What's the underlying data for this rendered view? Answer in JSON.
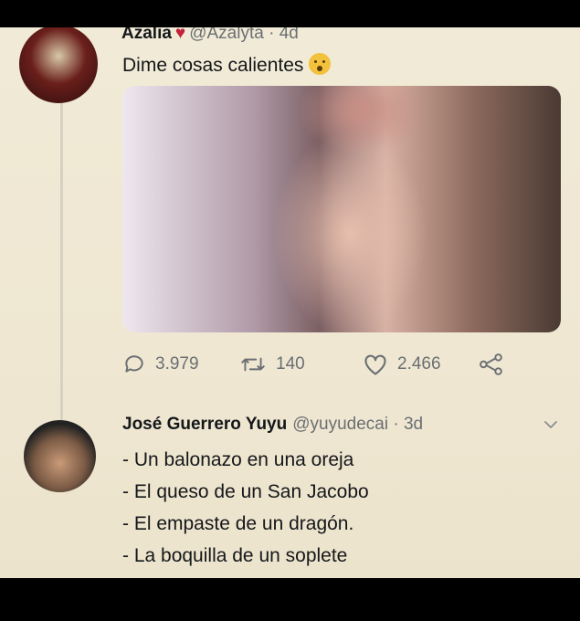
{
  "tweet1": {
    "name": "Azalia",
    "handle": "@Azalyta",
    "age": "4d",
    "text": "Dime cosas calientes",
    "stats": {
      "replies": "3.979",
      "retweets": "140",
      "likes": "2.466"
    }
  },
  "tweet2": {
    "name": "José Guerrero Yuyu",
    "handle": "@yuyudecai",
    "age": "3d",
    "lines": [
      "- Un balonazo en una oreja",
      "- El queso de un San Jacobo",
      "- El empaste de un dragón.",
      "- La boquilla de un soplete"
    ]
  },
  "icons": {
    "reply": "comment-icon",
    "retweet": "retweet-icon",
    "like": "heart-icon",
    "share": "share-icon",
    "more": "chevron-down-icon",
    "emoji": "worried-face-emoji"
  },
  "colors": {
    "text": "#14171a",
    "muted": "#6b6f73",
    "card_bg": "#efe7d2",
    "verified_heart": "#c4213a"
  }
}
